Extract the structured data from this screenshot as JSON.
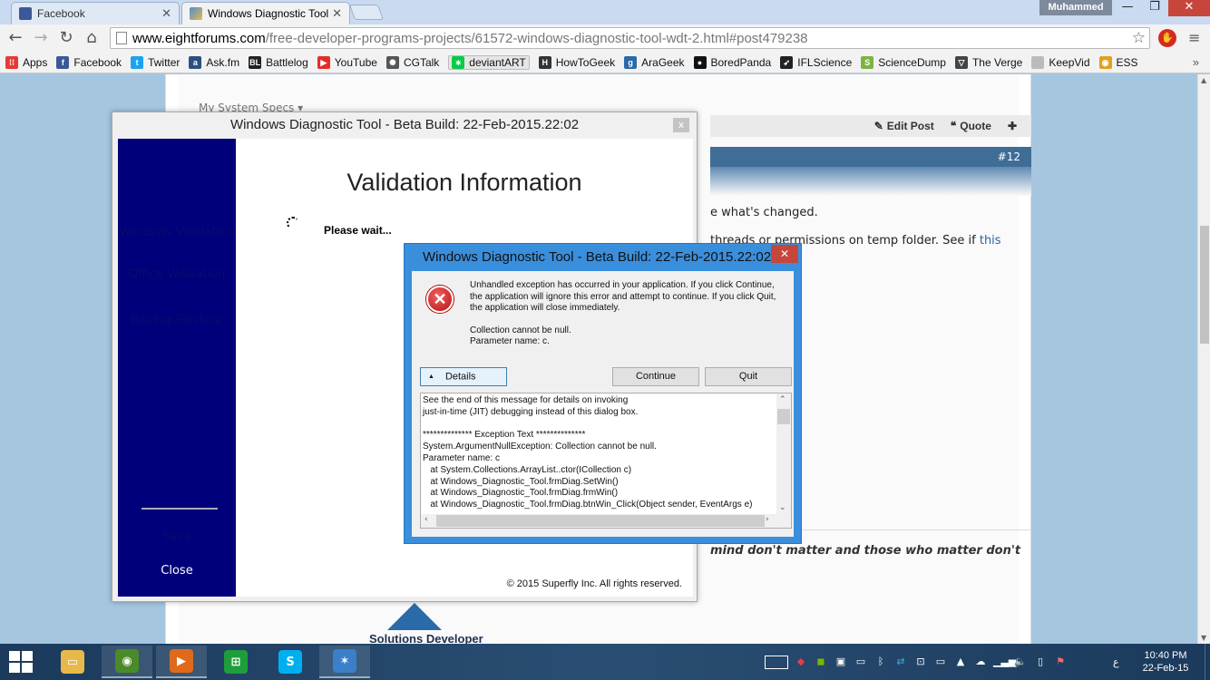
{
  "browser": {
    "tabs": [
      {
        "label": "Facebook",
        "color": "#3b5998",
        "active": false
      },
      {
        "label": "Windows Diagnostic Tool",
        "color": "#4a8fd8",
        "active": true
      }
    ],
    "user": "Muhammed",
    "url_host": "www.eightforums.com",
    "url_path": "/free-developer-programs-projects/61572-windows-diagnostic-tool-wdt-2.html#post479238",
    "bookmarks": [
      {
        "label": "Apps",
        "icon": "apps-grid-icon",
        "color": "#e53935",
        "glyph": "⁞⁞"
      },
      {
        "label": "Facebook",
        "icon": "facebook-icon",
        "color": "#3b5998",
        "glyph": "f"
      },
      {
        "label": "Twitter",
        "icon": "twitter-icon",
        "color": "#1da1f2",
        "glyph": "t"
      },
      {
        "label": "Ask.fm",
        "icon": "askfm-icon",
        "color": "#2b4f80",
        "glyph": "a"
      },
      {
        "label": "Battlelog",
        "icon": "battlelog-icon",
        "color": "#222222",
        "glyph": "BL"
      },
      {
        "label": "YouTube",
        "icon": "youtube-icon",
        "color": "#e52d27",
        "glyph": "▶"
      },
      {
        "label": "CGTalk",
        "icon": "cgtalk-icon",
        "color": "#555555",
        "glyph": "✺"
      },
      {
        "label": "deviantART",
        "icon": "deviantart-icon",
        "color": "#05cc47",
        "glyph": "∗"
      },
      {
        "label": "HowToGeek",
        "icon": "howtogeek-icon",
        "color": "#333333",
        "glyph": "H"
      },
      {
        "label": "AraGeek",
        "icon": "arageek-icon",
        "color": "#2a6aa8",
        "glyph": "g"
      },
      {
        "label": "BoredPanda",
        "icon": "boredpanda-icon",
        "color": "#111111",
        "glyph": "●"
      },
      {
        "label": "IFLScience",
        "icon": "iflscience-icon",
        "color": "#222222",
        "glyph": "➶"
      },
      {
        "label": "ScienceDump",
        "icon": "sciencedump-icon",
        "color": "#7cb342",
        "glyph": "S"
      },
      {
        "label": "The Verge",
        "icon": "the-verge-icon",
        "color": "#444444",
        "glyph": "▽"
      },
      {
        "label": "KeepVid",
        "icon": "page-icon",
        "color": "#bbbbbb",
        "glyph": ""
      },
      {
        "label": "ESS",
        "icon": "ess-icon",
        "color": "#e0a020",
        "glyph": "◉"
      }
    ]
  },
  "forum": {
    "specs_label": "My System Specs",
    "edit_post": "Edit Post",
    "quote": "Quote",
    "post_number": "#12",
    "line1": "e what's changed.",
    "line2": "threads or permissions on temp folder. See if",
    "line2_link": "this",
    "signature": "mind don't matter and those who matter don't",
    "logo_text": "Solutions Developer"
  },
  "wdt": {
    "title": "Windows Diagnostic Tool - Beta Build: 22-Feb-2015.22:02",
    "close_label": "x",
    "heading": "Validation Information",
    "status": "Please wait...",
    "nav": {
      "windows_validation": "Windows Validation",
      "office_validation": "Office Validation",
      "backup_restore": "Backup/Restore",
      "save": "Save",
      "close": "Close"
    },
    "copyright": "© 2015 Superfly Inc.  All rights reserved."
  },
  "error_dialog": {
    "title": "Windows Diagnostic Tool - Beta Build: 22-Feb-2015.22:02",
    "close_label": "✕",
    "message1": "Unhandled exception has occurred in your application. If you click Continue, the application will ignore this error and attempt to continue. If you click Quit, the application will close immediately.",
    "message2": "Collection cannot be null.",
    "message3": "Parameter name: c.",
    "details_label": "Details",
    "continue_label": "Continue",
    "quit_label": "Quit",
    "details_text": "See the end of this message for details on invoking\njust-in-time (JIT) debugging instead of this dialog box.\n\n************** Exception Text **************\nSystem.ArgumentNullException: Collection cannot be null.\nParameter name: c\n   at System.Collections.ArrayList..ctor(ICollection c)\n   at Windows_Diagnostic_Tool.frmDiag.SetWin()\n   at Windows_Diagnostic_Tool.frmDiag.frmWin()\n   at Windows_Diagnostic_Tool.frmDiag.btnWin_Click(Object sender, EventArgs e)"
  },
  "taskbar": {
    "apps": [
      {
        "name": "file-explorer-icon",
        "color": "#e8b84a",
        "glyph": "▭",
        "open": false
      },
      {
        "name": "chrome-icon",
        "color": "#4a8a2a",
        "glyph": "◉",
        "open": true
      },
      {
        "name": "media-player-icon",
        "color": "#e06a1a",
        "glyph": "▶",
        "open": true
      },
      {
        "name": "store-icon",
        "color": "#1e9e3a",
        "glyph": "⊞",
        "open": false
      },
      {
        "name": "skype-icon",
        "color": "#00aff0",
        "glyph": "S",
        "open": false
      },
      {
        "name": "diagnostic-tool-icon",
        "color": "#3a7fc8",
        "glyph": "✶",
        "open": true
      }
    ],
    "lang": "ع",
    "time": "10:40 PM",
    "date": "22-Feb-15"
  }
}
